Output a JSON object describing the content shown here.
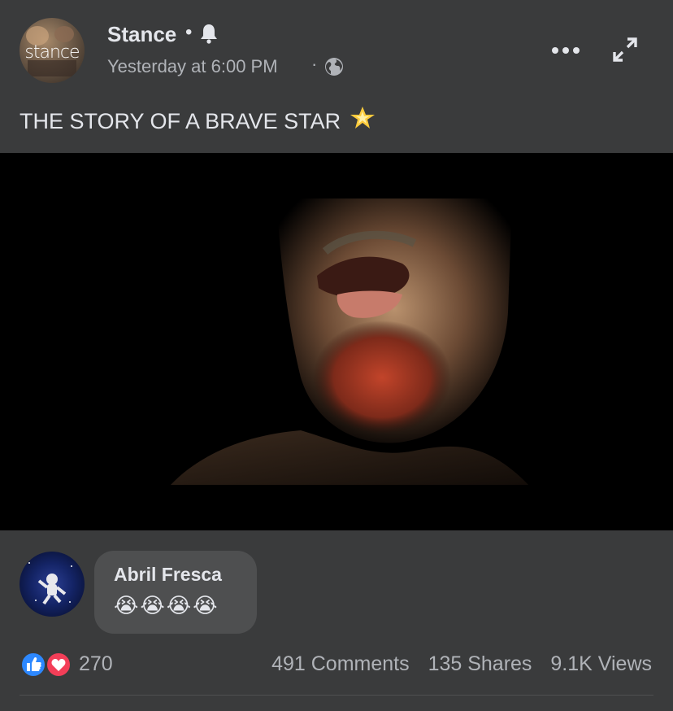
{
  "post": {
    "page_name": "Stance",
    "name_separator": "•",
    "timestamp": "Yesterday at 6:00 PM",
    "time_separator": "·",
    "avatar_logo_text": "stance",
    "caption": "THE STORY OF A BRAVE STAR",
    "caption_emoji": "glowing-star"
  },
  "icons": {
    "bell": "bell-icon",
    "globe": "globe-icon",
    "more": "more-options-icon",
    "expand": "expand-icon",
    "like": "like-reaction-icon",
    "love": "love-reaction-icon"
  },
  "comment": {
    "author": "Abril Fresca",
    "emoji_text": "😭😭😭😭"
  },
  "stats": {
    "reactions": "270",
    "comments": "491 Comments",
    "shares": "135 Shares",
    "views": "9.1K Views"
  },
  "colors": {
    "background": "#3a3b3c",
    "like_blue": "#2d88ff",
    "love_red": "#f33e58"
  }
}
